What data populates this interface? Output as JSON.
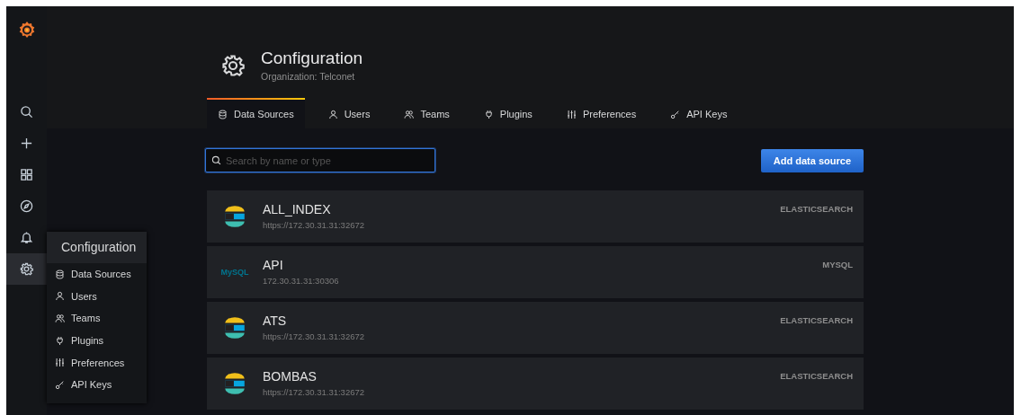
{
  "sidebar": {
    "items": [
      {
        "kind": "search",
        "selected": false
      },
      {
        "kind": "create",
        "selected": false
      },
      {
        "kind": "dashboards",
        "selected": false
      },
      {
        "kind": "explore",
        "selected": false
      },
      {
        "kind": "alerting",
        "selected": false
      },
      {
        "kind": "configuration",
        "selected": true
      }
    ]
  },
  "flyout": {
    "title": "Configuration",
    "items": [
      {
        "kind": "datasources",
        "label": "Data Sources"
      },
      {
        "kind": "users",
        "label": "Users"
      },
      {
        "kind": "teams",
        "label": "Teams"
      },
      {
        "kind": "plugins",
        "label": "Plugins"
      },
      {
        "kind": "preferences",
        "label": "Preferences"
      },
      {
        "kind": "apikeys",
        "label": "API Keys"
      }
    ]
  },
  "header": {
    "title": "Configuration",
    "subtitle": "Organization: Telconet"
  },
  "tabs": [
    {
      "kind": "datasources",
      "label": "Data Sources",
      "selected": true
    },
    {
      "kind": "users",
      "label": "Users",
      "selected": false
    },
    {
      "kind": "teams",
      "label": "Teams",
      "selected": false
    },
    {
      "kind": "plugins",
      "label": "Plugins",
      "selected": false
    },
    {
      "kind": "preferences",
      "label": "Preferences",
      "selected": false
    },
    {
      "kind": "apikeys",
      "label": "API Keys",
      "selected": false
    }
  ],
  "search": {
    "placeholder": "Search by name or type"
  },
  "add_button": "Add data source",
  "datasources": [
    {
      "kind": "elasticsearch",
      "name": "ALL_INDEX",
      "url": "https://172.30.31.31:32672",
      "type": "ELASTICSEARCH"
    },
    {
      "kind": "mysql",
      "name": "API",
      "url": "172.30.31.31:30306",
      "type": "MYSQL",
      "logo": "MySQL"
    },
    {
      "kind": "elasticsearch",
      "name": "ATS",
      "url": "https://172.30.31.31:32672",
      "type": "ELASTICSEARCH"
    },
    {
      "kind": "elasticsearch",
      "name": "BOMBAS",
      "url": "https://172.30.31.31:32672",
      "type": "ELASTICSEARCH"
    }
  ]
}
